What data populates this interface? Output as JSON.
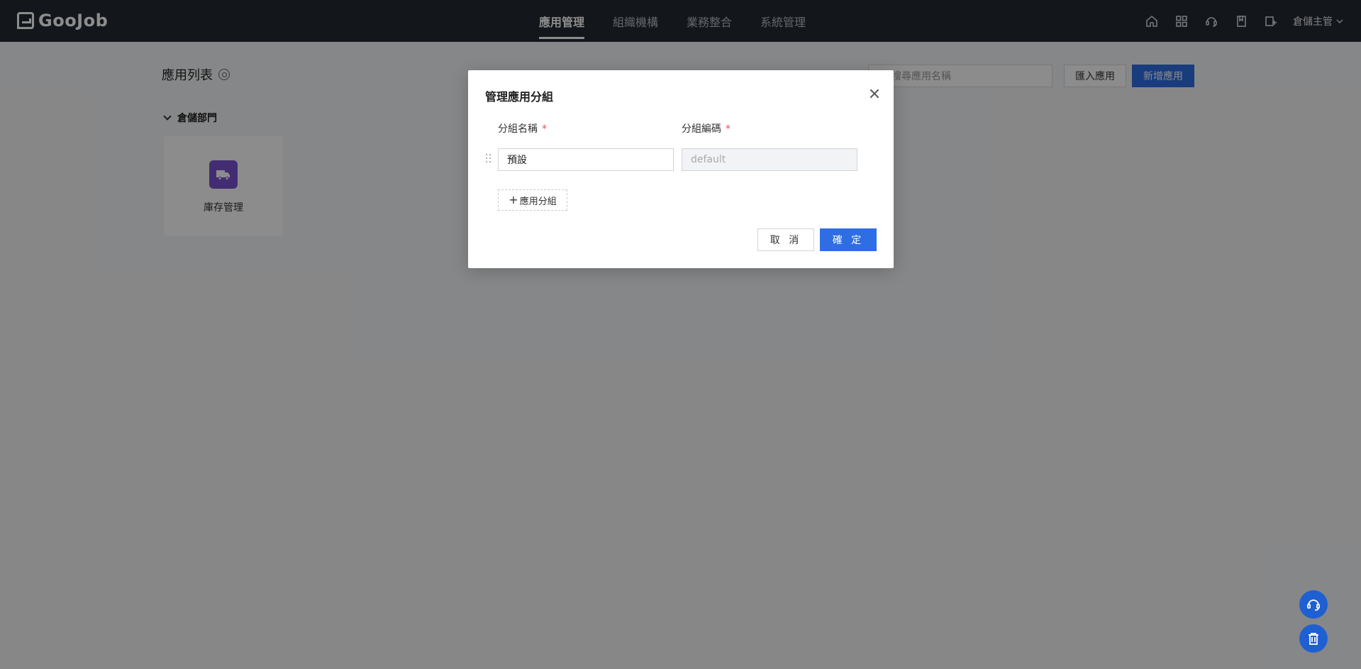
{
  "brand": {
    "name": "GooJob"
  },
  "nav": {
    "items": [
      {
        "label": "應用管理",
        "active": true
      },
      {
        "label": "組織機構",
        "active": false
      },
      {
        "label": "業務整合",
        "active": false
      },
      {
        "label": "系統管理",
        "active": false
      }
    ]
  },
  "header_icons": [
    "home-icon",
    "apps-grid-icon",
    "support-icon",
    "book-icon",
    "add-app-icon"
  ],
  "user": {
    "name": "倉儲主管"
  },
  "page": {
    "title": "應用列表",
    "search_placeholder": "搜尋應用名稱",
    "import_label": "匯入應用",
    "new_label": "新增應用",
    "group_name": "倉儲部門",
    "apps": [
      {
        "label": "庫存管理",
        "icon": "delivery-truck-icon",
        "color": "#7a52cf"
      }
    ]
  },
  "modal": {
    "title": "管理應用分組",
    "col_name_label": "分組名稱",
    "col_code_label": "分組編碼",
    "required_mark": "*",
    "rows": [
      {
        "name": "預設",
        "code": "default"
      }
    ],
    "add_group_label": "應用分組",
    "cancel_label": "取 消",
    "ok_label": "確 定"
  },
  "colors": {
    "primary": "#2f6de4",
    "topbar": "#232831",
    "danger": "#e34d59"
  }
}
